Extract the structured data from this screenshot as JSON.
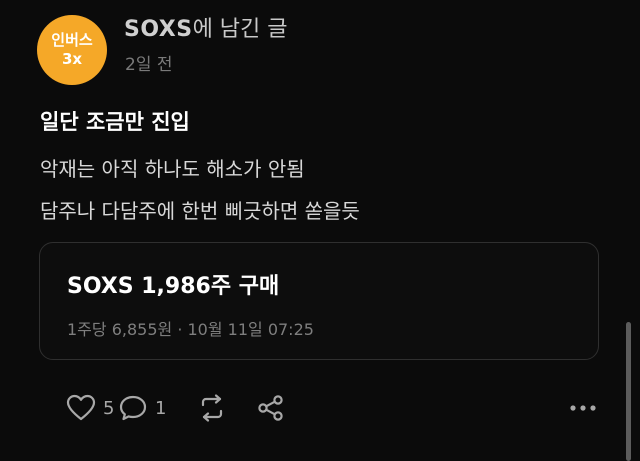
{
  "post": {
    "avatar": {
      "line1": "인버스",
      "line2": "3x",
      "color": "#f5a828"
    },
    "ticker": "SOXS",
    "title_suffix": "에 남긴 글",
    "time": "2일 전",
    "headline": "일단 조금만 진입",
    "body": [
      "악재는 아직 하나도 해소가 안됨",
      "담주나 다담주에 한번 삐긋하면 쏟을듯"
    ]
  },
  "trade": {
    "title": "SOXS 1,986주 구매",
    "meta": "1주당 6,855원 · 10월 11일 07:25"
  },
  "actions": {
    "like_count": "5",
    "comment_count": "1",
    "icons": [
      "heart-icon",
      "comment-icon",
      "repost-icon",
      "share-icon",
      "more-icon"
    ]
  },
  "colors": {
    "background": "#0b0b0b",
    "text": "#ffffff",
    "muted": "#7a7a7a",
    "card_border": "#2f2f2f"
  }
}
